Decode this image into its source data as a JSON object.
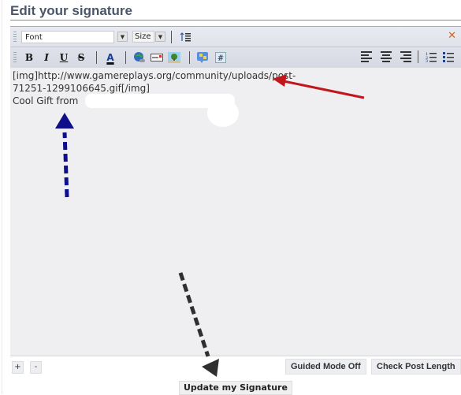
{
  "header": {
    "title": "Edit your signature"
  },
  "toolbar": {
    "font_label": "Font",
    "size_label": "Size",
    "bold": "B",
    "italic": "I",
    "underline": "U",
    "strike": "S",
    "font_color": "A",
    "close": "✕",
    "icons": [
      "switch-editor-icon",
      "bold-icon",
      "italic-icon",
      "underline-icon",
      "strikethrough-icon",
      "font-color-icon",
      "link-icon",
      "email-icon",
      "image-icon",
      "emoticon-icon",
      "code-icon",
      "align-left-icon",
      "align-center-icon",
      "align-right-icon",
      "ordered-list-icon",
      "unordered-list-icon"
    ]
  },
  "editor": {
    "content": "[img]http://www.gamereplays.org/community/uploads/post-\n71251-1299106645.gif[/img]\nCool Gift from"
  },
  "annotations": {
    "red_arrow_color": "#c0161c",
    "blue_arrow_color": "#0f0f8a",
    "black_arrow_color": "#2f2f2f"
  },
  "footer": {
    "plus_label": "+",
    "minus_label": "-",
    "guided_mode_label": "Guided Mode Off",
    "check_length_label": "Check Post Length",
    "update_label": "Update my Signature"
  }
}
